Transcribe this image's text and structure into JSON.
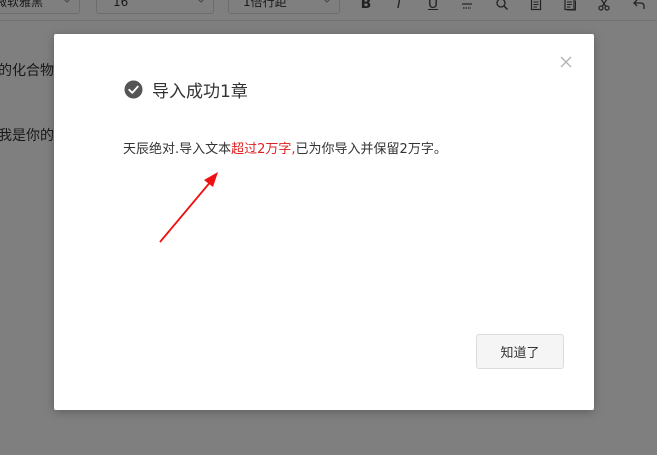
{
  "toolbar": {
    "font_family_value": "微软雅黑",
    "font_size_value": "16",
    "line_spacing_value": "1倍行距",
    "icons": [
      "bold-icon",
      "italic-icon",
      "underline-icon",
      "strikethrough-icon",
      "search-icon",
      "document-icon",
      "document-copy-icon",
      "scissors-icon",
      "undo-icon"
    ],
    "bold_glyph": "B",
    "italic_glyph": "I",
    "underline_glyph": "U"
  },
  "editor": {
    "line1": "的化合物",
    "line2": "我是你的"
  },
  "modal": {
    "title": "导入成功1章",
    "message_prefix": "天辰绝对.导入文本",
    "message_highlight": "超过2万字,",
    "message_suffix": "已为你导入并保留2万字。",
    "confirm_label": "知道了",
    "highlight_color": "#e02020",
    "arrow_color": "#ee1111"
  }
}
